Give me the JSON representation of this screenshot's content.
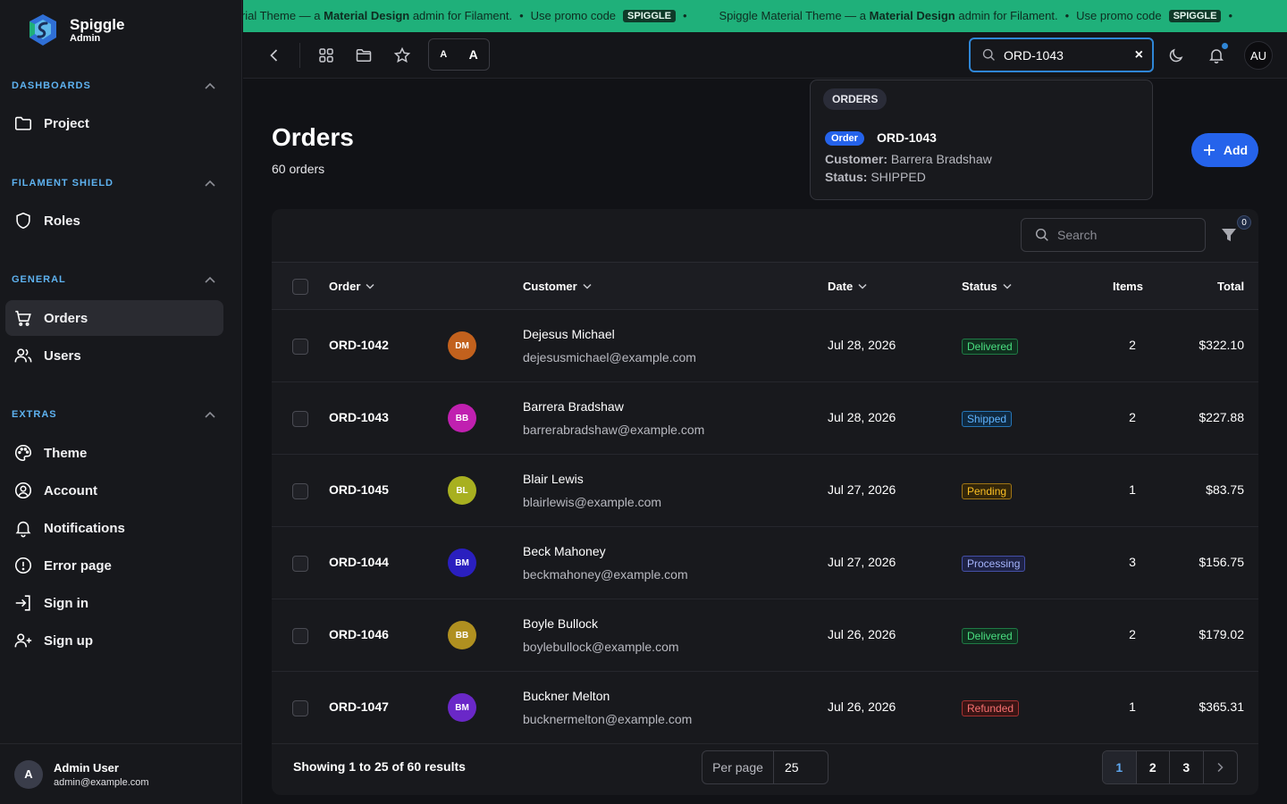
{
  "brand": {
    "name": "Spiggle",
    "sub": "Admin"
  },
  "sidebar": {
    "groups": [
      {
        "label": "DASHBOARDS",
        "items": [
          {
            "label": "Project",
            "icon": "folder-icon"
          }
        ]
      },
      {
        "label": "FILAMENT SHIELD",
        "items": [
          {
            "label": "Roles",
            "icon": "shield-icon"
          }
        ]
      },
      {
        "label": "GENERAL",
        "items": [
          {
            "label": "Orders",
            "icon": "cart-icon",
            "active": true
          },
          {
            "label": "Users",
            "icon": "users-icon"
          }
        ]
      },
      {
        "label": "EXTRAS",
        "items": [
          {
            "label": "Theme",
            "icon": "palette-icon"
          },
          {
            "label": "Account",
            "icon": "user-circle-icon"
          },
          {
            "label": "Notifications",
            "icon": "bell-icon"
          },
          {
            "label": "Error page",
            "icon": "alert-circle-icon"
          },
          {
            "label": "Sign in",
            "icon": "sign-in-icon"
          },
          {
            "label": "Sign up",
            "icon": "user-plus-icon"
          }
        ]
      }
    ],
    "user": {
      "initial": "A",
      "name": "Admin User",
      "email": "admin@example.com"
    }
  },
  "promo": {
    "items": [
      {
        "pre": "Spiggle Material Theme — a ",
        "bold": "Material Design",
        "post": " admin for Filament.",
        "code_label": "Use promo code",
        "code": "SPIGGLE"
      },
      {
        "pre": "Spiggle Material Theme — a ",
        "bold": "Material Design",
        "post": " admin for Filament.",
        "code_label": "Use promo code",
        "code": "SPIGGLE"
      }
    ]
  },
  "topbar": {
    "font_small": "A",
    "font_large": "A",
    "search_value": "ORD-1043",
    "clear": "×",
    "avatar": "AU"
  },
  "search_results": {
    "group": "ORDERS",
    "badge": "Order",
    "title": "ORD-1043",
    "customer_label": "Customer:",
    "customer": "Barrera Bradshaw",
    "status_label": "Status:",
    "status": "SHIPPED"
  },
  "page": {
    "title": "Orders",
    "subtitle": "60 orders",
    "add_label": "Add"
  },
  "table": {
    "search_placeholder": "Search",
    "filter_count": "0",
    "columns": {
      "order": "Order",
      "customer": "Customer",
      "date": "Date",
      "status": "Status",
      "items": "Items",
      "total": "Total"
    },
    "rows": [
      {
        "order": "ORD-1042",
        "initials": "DM",
        "avatar_color": "#c2611d",
        "name": "Dejesus Michael",
        "email": "dejesusmichael@example.com",
        "date": "Jul 28, 2026",
        "status": "Delivered",
        "status_kind": "green",
        "items": "2",
        "total": "$322.10"
      },
      {
        "order": "ORD-1043",
        "initials": "BB",
        "avatar_color": "#c020b0",
        "name": "Barrera Bradshaw",
        "email": "barrerabradshaw@example.com",
        "date": "Jul 28, 2026",
        "status": "Shipped",
        "status_kind": "blue",
        "items": "2",
        "total": "$227.88"
      },
      {
        "order": "ORD-1045",
        "initials": "BL",
        "avatar_color": "#a8b020",
        "name": "Blair Lewis",
        "email": "blairlewis@example.com",
        "date": "Jul 27, 2026",
        "status": "Pending",
        "status_kind": "amber",
        "items": "1",
        "total": "$83.75"
      },
      {
        "order": "ORD-1044",
        "initials": "BM",
        "avatar_color": "#2a1fbf",
        "name": "Beck Mahoney",
        "email": "beckmahoney@example.com",
        "date": "Jul 27, 2026",
        "status": "Processing",
        "status_kind": "indigo",
        "items": "3",
        "total": "$156.75"
      },
      {
        "order": "ORD-1046",
        "initials": "BB",
        "avatar_color": "#b09020",
        "name": "Boyle Bullock",
        "email": "boylebullock@example.com",
        "date": "Jul 26, 2026",
        "status": "Delivered",
        "status_kind": "green",
        "items": "2",
        "total": "$179.02"
      },
      {
        "order": "ORD-1047",
        "initials": "BM",
        "avatar_color": "#6a28c8",
        "name": "Buckner Melton",
        "email": "bucknermelton@example.com",
        "date": "Jul 26, 2026",
        "status": "Refunded",
        "status_kind": "red",
        "items": "1",
        "total": "$365.31"
      }
    ],
    "footer": {
      "summary": "Showing 1 to 25 of 60 results",
      "per_page_label": "Per page",
      "per_page_value": "25",
      "pages": [
        "1",
        "2",
        "3"
      ],
      "current_page": "1"
    }
  },
  "colors": {
    "accent": "#2563eb",
    "promo": "#1fb07a",
    "group_label": "#5eb2f0"
  }
}
